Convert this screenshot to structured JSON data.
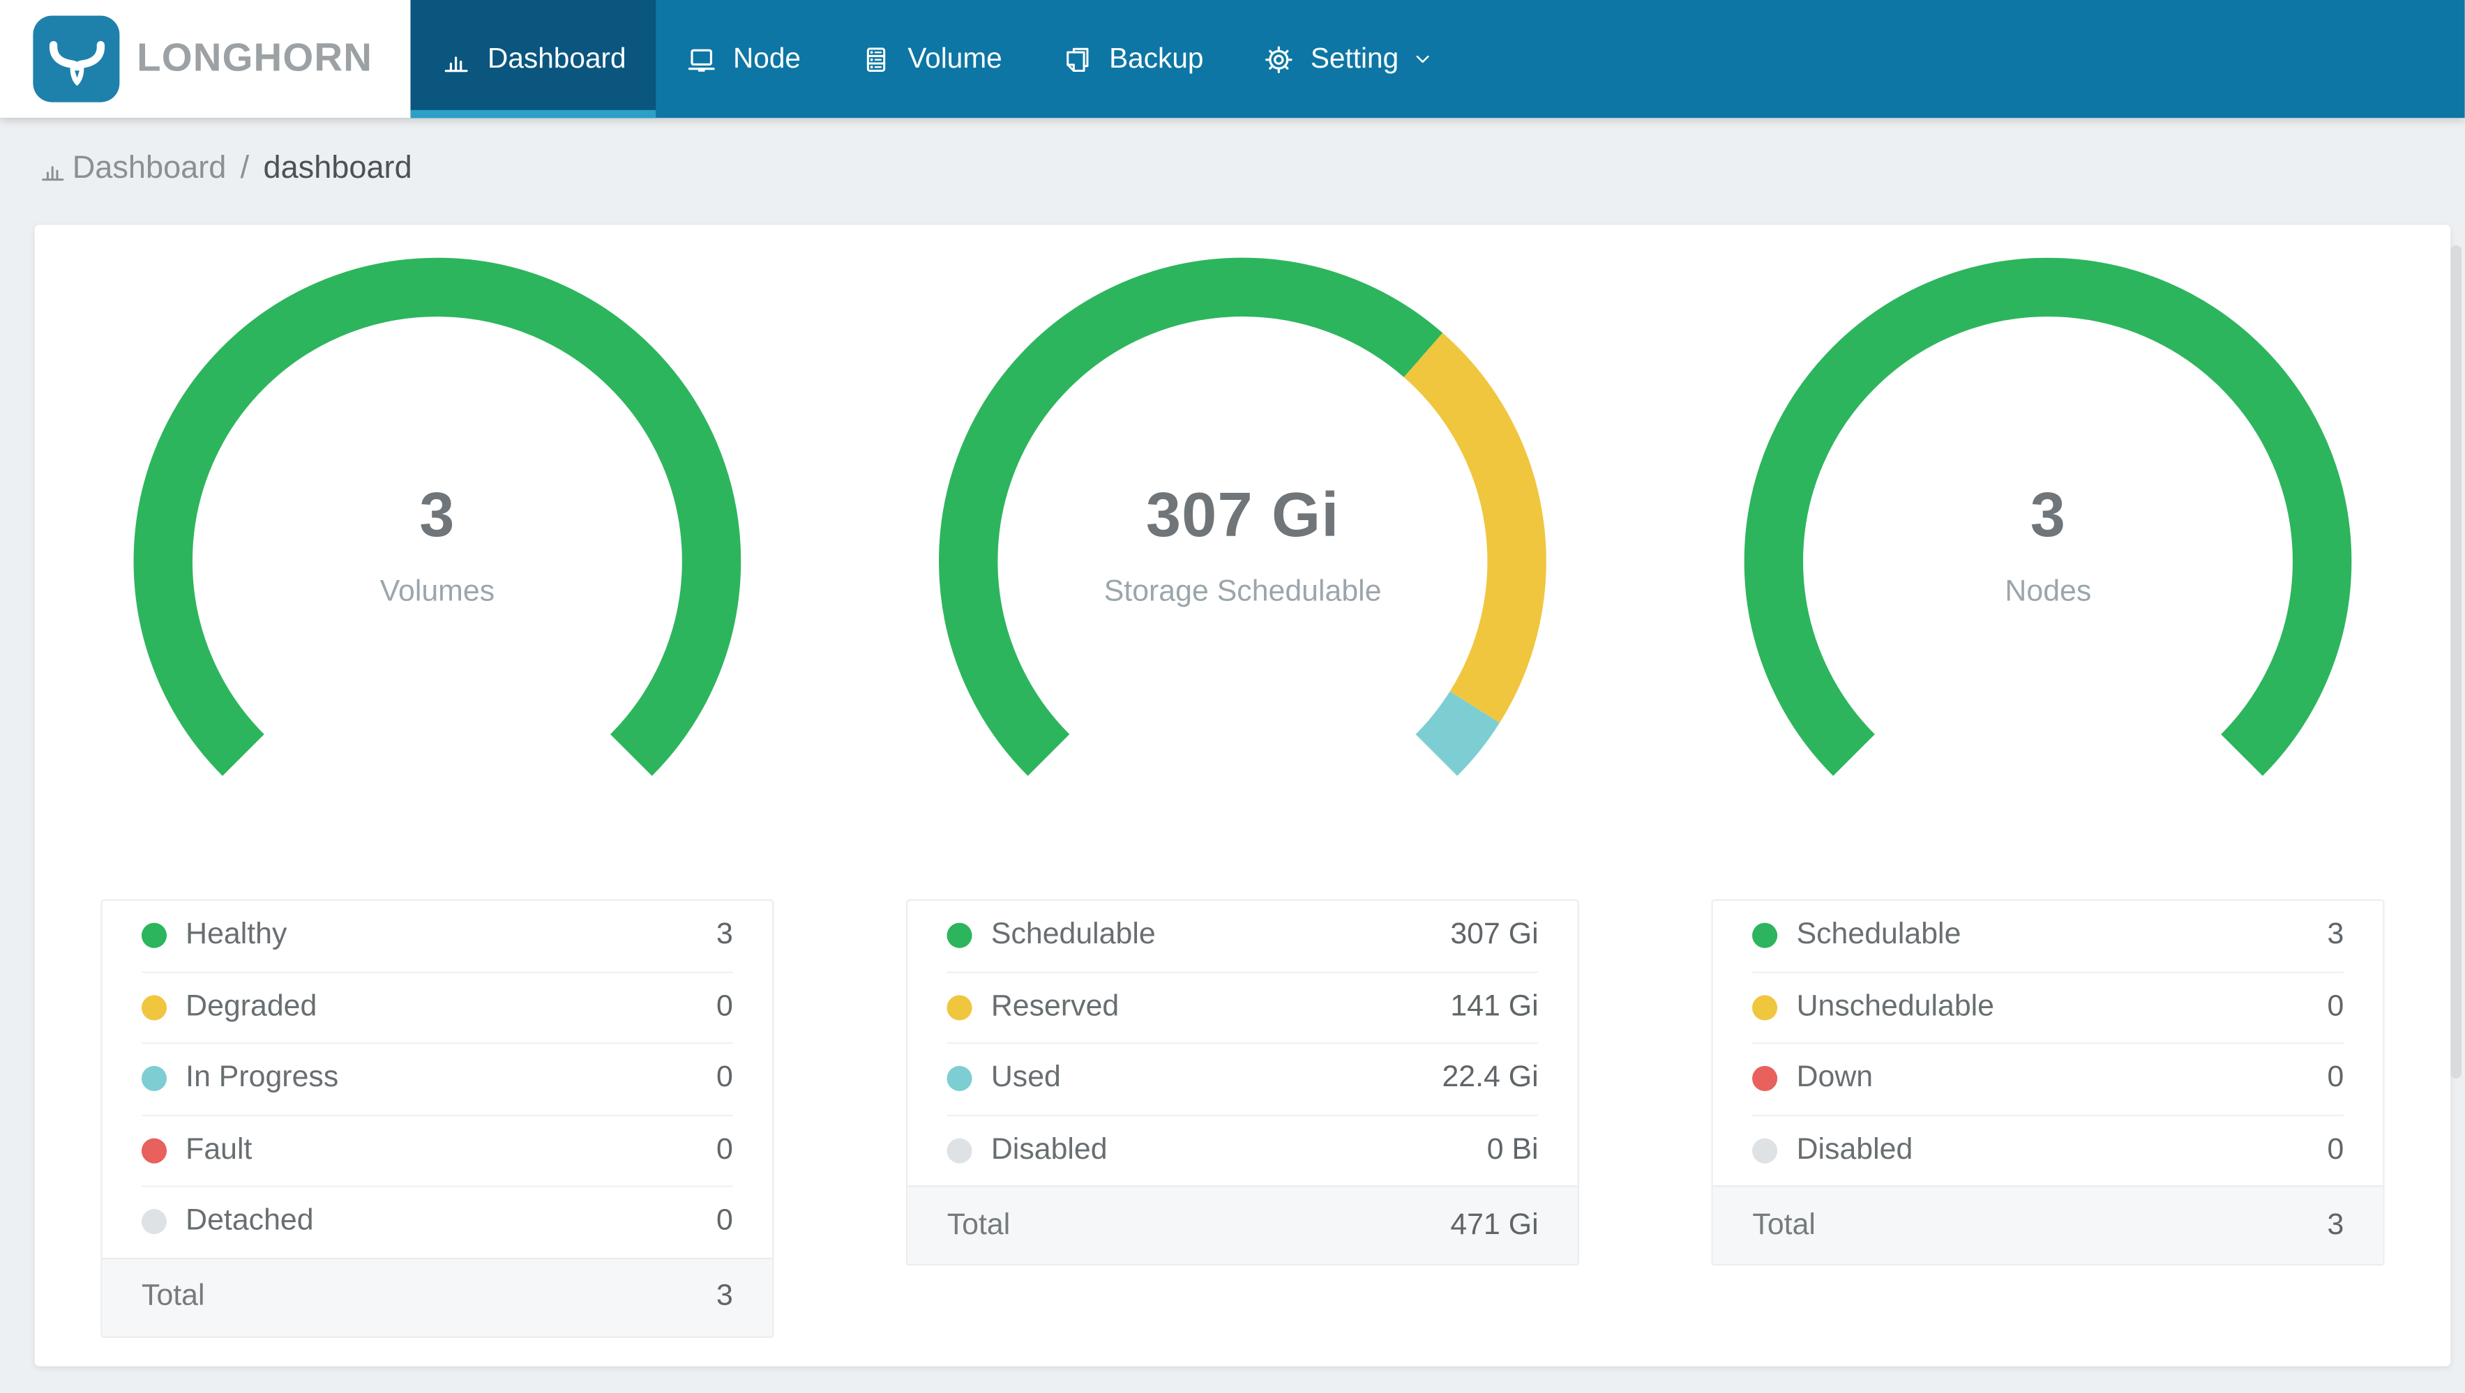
{
  "nav": {
    "brand": "LONGHORN",
    "items": [
      {
        "label": "Dashboard",
        "icon": "dashboard-chart-icon",
        "active": true
      },
      {
        "label": "Node",
        "icon": "node-icon",
        "active": false
      },
      {
        "label": "Volume",
        "icon": "volume-icon",
        "active": false
      },
      {
        "label": "Backup",
        "icon": "backup-icon",
        "active": false
      },
      {
        "label": "Setting",
        "icon": "setting-gear-icon",
        "active": false,
        "has_dropdown": true
      }
    ]
  },
  "breadcrumb": {
    "icon": "dashboard-chart-icon",
    "section": "Dashboard",
    "separator": "/",
    "page": "dashboard"
  },
  "colors": {
    "nav_background": "#0d76a4",
    "nav_active_background": "#0a567f",
    "nav_active_accent": "#2aa1c5",
    "brand_tile_blue": "#1d81ac",
    "brand_text_gray": "#9ba1a4",
    "page_background": "#edf0f2",
    "card_background": "#ffffff",
    "status_green": "#2db55d",
    "status_yellow": "#f0c63f",
    "status_teal": "#7dced2",
    "status_red": "#e8615c",
    "status_gray": "#dfe2e5",
    "center_number_gray": "#6f7578",
    "center_label_gray": "#9ba6ac"
  },
  "chart_data": [
    {
      "type": "donut-gauge",
      "name": "volumes",
      "center_value": "3",
      "center_label": "Volumes",
      "arc": {
        "start_angle": 135,
        "sweep_angle": 270,
        "direction": "clockwise"
      },
      "segments": [
        {
          "label": "Healthy",
          "value": 3,
          "display": "3",
          "color": "#2db55d"
        },
        {
          "label": "Degraded",
          "value": 0,
          "display": "0",
          "color": "#f0c63f"
        },
        {
          "label": "In Progress",
          "value": 0,
          "display": "0",
          "color": "#7dced2"
        },
        {
          "label": "Fault",
          "value": 0,
          "display": "0",
          "color": "#e8615c"
        },
        {
          "label": "Detached",
          "value": 0,
          "display": "0",
          "color": "#dfe2e5"
        }
      ],
      "total": {
        "label": "Total",
        "display": "3"
      }
    },
    {
      "type": "donut-gauge",
      "name": "storage-schedulable",
      "center_value": "307 Gi",
      "center_label": "Storage Schedulable",
      "arc": {
        "start_angle": 135,
        "sweep_angle": 270,
        "direction": "clockwise"
      },
      "segments": [
        {
          "label": "Schedulable",
          "value": 307,
          "display": "307 Gi",
          "color": "#2db55d"
        },
        {
          "label": "Reserved",
          "value": 141,
          "display": "141 Gi",
          "color": "#f0c63f"
        },
        {
          "label": "Used",
          "value": 22.4,
          "display": "22.4 Gi",
          "color": "#7dced2"
        },
        {
          "label": "Disabled",
          "value": 0,
          "display": "0 Bi",
          "color": "#dfe2e5"
        }
      ],
      "total": {
        "label": "Total",
        "display": "471 Gi"
      }
    },
    {
      "type": "donut-gauge",
      "name": "nodes",
      "center_value": "3",
      "center_label": "Nodes",
      "arc": {
        "start_angle": 135,
        "sweep_angle": 270,
        "direction": "clockwise"
      },
      "segments": [
        {
          "label": "Schedulable",
          "value": 3,
          "display": "3",
          "color": "#2db55d"
        },
        {
          "label": "Unschedulable",
          "value": 0,
          "display": "0",
          "color": "#f0c63f"
        },
        {
          "label": "Down",
          "value": 0,
          "display": "0",
          "color": "#e8615c"
        },
        {
          "label": "Disabled",
          "value": 0,
          "display": "0",
          "color": "#dfe2e5"
        }
      ],
      "total": {
        "label": "Total",
        "display": "3"
      }
    }
  ]
}
